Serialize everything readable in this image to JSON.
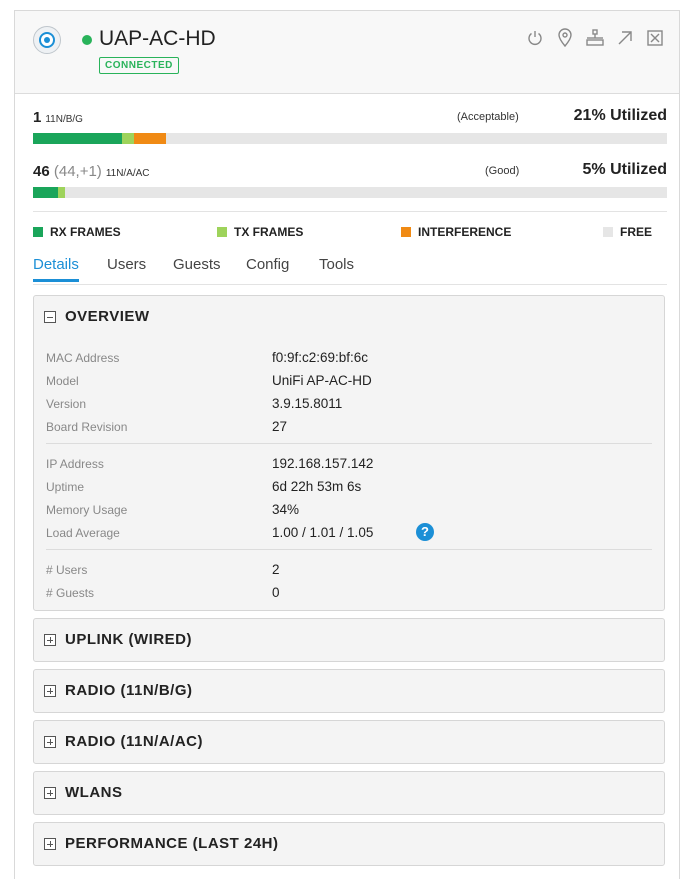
{
  "device": {
    "name": "UAP-AC-HD",
    "status": "CONNECTED",
    "status_color": "#29b35a",
    "icon": "device-circle-icon"
  },
  "header_actions": [
    {
      "name": "power-icon"
    },
    {
      "name": "locate-icon"
    },
    {
      "name": "network-icon"
    },
    {
      "name": "expand-icon"
    },
    {
      "name": "close-icon"
    }
  ],
  "radios": [
    {
      "channel": "1",
      "channel_detail": "",
      "standard": "11N/B/G",
      "quality": "(Acceptable)",
      "utilization": "21% Utilized",
      "rx_frames": 0.14,
      "tx_frames": 0.02,
      "interference": 0.05
    },
    {
      "channel": "46",
      "channel_detail": "(44,+1)",
      "standard": "11N/A/AC",
      "quality": "(Good)",
      "utilization": "5% Utilized",
      "rx_frames": 0.04,
      "tx_frames": 0.01,
      "interference": 0.0
    }
  ],
  "legend": {
    "rx": "RX FRAMES",
    "tx": "TX FRAMES",
    "interference": "INTERFERENCE",
    "free": "FREE",
    "colors": {
      "rx": "#1aa55a",
      "tx": "#9ed35b",
      "interference": "#f08a14",
      "free": "#e6e6e6"
    }
  },
  "tabs": [
    "Details",
    "Users",
    "Guests",
    "Config",
    "Tools"
  ],
  "active_tab": "Details",
  "overview": {
    "title": "OVERVIEW",
    "fields": [
      {
        "label": "MAC Address",
        "value": "f0:9f:c2:69:bf:6c"
      },
      {
        "label": "Model",
        "value": "UniFi AP-AC-HD"
      },
      {
        "label": "Version",
        "value": "3.9.15.8011"
      },
      {
        "label": "Board Revision",
        "value": "27"
      },
      {
        "label": "IP Address",
        "value": "192.168.157.142"
      },
      {
        "label": "Uptime",
        "value": "6d 22h 53m 6s"
      },
      {
        "label": "Memory Usage",
        "value": "34%"
      },
      {
        "label": "Load Average",
        "value": "1.00 / 1.01 / 1.05"
      },
      {
        "label": "# Users",
        "value": "2"
      },
      {
        "label": "# Guests",
        "value": "0"
      }
    ],
    "help": "?"
  },
  "sections": [
    {
      "title": "UPLINK (WIRED)"
    },
    {
      "title": "RADIO (11N/B/G)"
    },
    {
      "title": "RADIO (11N/A/AC)"
    },
    {
      "title": "WLANS"
    },
    {
      "title": "PERFORMANCE (LAST 24H)"
    }
  ]
}
